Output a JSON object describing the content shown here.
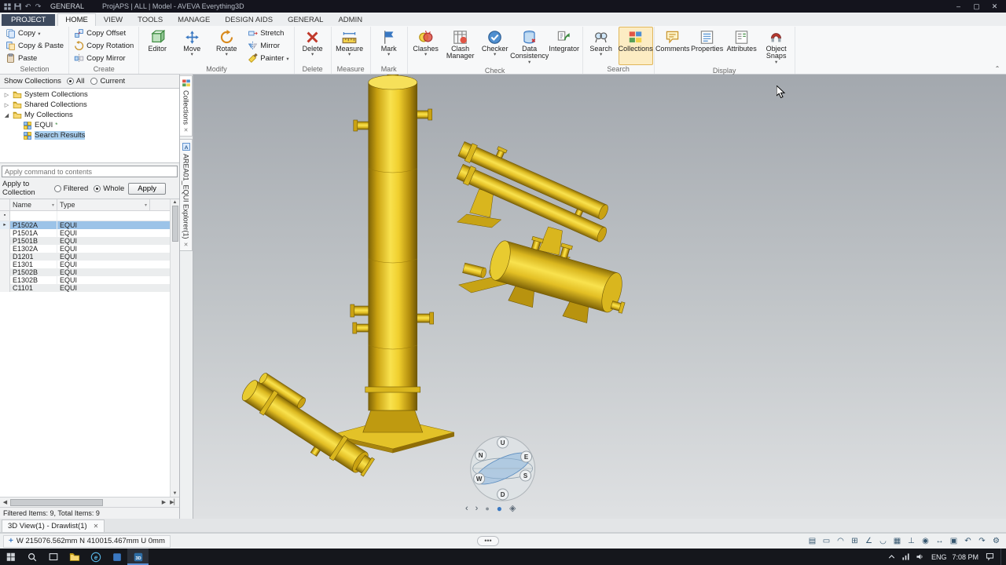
{
  "colors": {
    "accent_blue": "#3a78c2",
    "equipment_yellow": "#f0cd2b",
    "titlebar_bg": "#14141d",
    "taskbar_bg": "#15171c",
    "selection_blue": "#9cc3e8",
    "project_tab_bg": "#3e4a5e"
  },
  "titlebar": {
    "menu_label": "GENERAL",
    "title": "ProjAPS | ALL | Model - AVEVA Everything3D",
    "quick_icons": [
      "app-icon",
      "save-icon",
      "undo-icon",
      "redo-icon"
    ],
    "window_controls": [
      {
        "name": "minimize-button",
        "glyph": "–"
      },
      {
        "name": "maximize-button",
        "glyph": "▢"
      },
      {
        "name": "close-button",
        "glyph": "✕"
      }
    ]
  },
  "ribbon": {
    "active_tab": "HOME",
    "tabs": [
      "PROJECT",
      "HOME",
      "VIEW",
      "TOOLS",
      "MANAGE",
      "DESIGN AIDS",
      "GENERAL",
      "ADMIN"
    ],
    "groups": [
      {
        "label": "Selection",
        "stack": [
          {
            "label": "Copy",
            "icon": "copy",
            "dropdown": true
          },
          {
            "label": "Copy & Paste",
            "icon": "copy-paste",
            "dropdown": false
          },
          {
            "label": "Paste",
            "icon": "paste",
            "dropdown": false
          }
        ]
      },
      {
        "label": "Create",
        "stack": [
          {
            "label": "Copy Offset",
            "icon": "copy-offset",
            "dropdown": false
          },
          {
            "label": "Copy Rotation",
            "icon": "copy-rotation",
            "dropdown": false
          },
          {
            "label": "Copy Mirror",
            "icon": "copy-mirror",
            "dropdown": false
          }
        ]
      },
      {
        "label": "Modify",
        "large": [
          {
            "label": "Editor",
            "icon": "editor",
            "dropdown": false
          },
          {
            "label": "Move",
            "icon": "move",
            "dropdown": true
          },
          {
            "label": "Rotate",
            "icon": "rotate",
            "dropdown": true
          }
        ],
        "stack": [
          {
            "label": "Stretch",
            "icon": "stretch",
            "dropdown": false
          },
          {
            "label": "Mirror",
            "icon": "mirror",
            "dropdown": false
          },
          {
            "label": "Painter",
            "icon": "painter",
            "dropdown": true
          }
        ]
      },
      {
        "label": "Delete",
        "large": [
          {
            "label": "Delete",
            "icon": "delete",
            "dropdown": true
          }
        ]
      },
      {
        "label": "Measure",
        "large": [
          {
            "label": "Measure",
            "icon": "measure",
            "dropdown": true
          }
        ]
      },
      {
        "label": "Mark",
        "large": [
          {
            "label": "Mark",
            "icon": "mark",
            "dropdown": true
          }
        ]
      },
      {
        "label": "Check",
        "large": [
          {
            "label": "Clashes",
            "icon": "clashes",
            "dropdown": true
          },
          {
            "label": "Clash Manager",
            "icon": "clash-manager",
            "dropdown": false
          },
          {
            "label": "Checker",
            "icon": "checker",
            "dropdown": true
          },
          {
            "label": "Data Consistency",
            "icon": "data-consistency",
            "dropdown": true
          },
          {
            "label": "Integrator",
            "icon": "integrator",
            "dropdown": false
          }
        ]
      },
      {
        "label": "Search",
        "large": [
          {
            "label": "Search",
            "icon": "search",
            "dropdown": true
          },
          {
            "label": "Collections",
            "icon": "collections",
            "dropdown": false,
            "active": true
          }
        ]
      },
      {
        "label": "Display",
        "large": [
          {
            "label": "Comments",
            "icon": "comments",
            "dropdown": false
          },
          {
            "label": "Properties",
            "icon": "properties",
            "dropdown": false
          },
          {
            "label": "Attributes",
            "icon": "attributes",
            "dropdown": false
          },
          {
            "label": "Object Snaps",
            "icon": "object-snaps",
            "dropdown": true
          }
        ]
      }
    ]
  },
  "panel": {
    "show_collections_label": "Show Collections",
    "show_options": [
      {
        "label": "All",
        "selected": true
      },
      {
        "label": "Current",
        "selected": false
      }
    ],
    "tree": [
      {
        "label": "System Collections",
        "level": 0,
        "children": true,
        "expanded": false,
        "icon": "folder-icon"
      },
      {
        "label": "Shared Collections",
        "level": 0,
        "children": true,
        "expanded": false,
        "icon": "folder-icon"
      },
      {
        "label": "My Collections",
        "level": 0,
        "children": true,
        "expanded": true,
        "icon": "folder-icon"
      },
      {
        "label": "EQUI",
        "level": 1,
        "children": false,
        "icon": "grid-collection-icon",
        "suffix": "*"
      },
      {
        "label": "Search Results",
        "level": 1,
        "children": false,
        "icon": "grid-collection-icon",
        "selected": true
      }
    ],
    "apply_input_placeholder": "Apply command to contents",
    "apply_to_label": "Apply to Collection",
    "apply_options": [
      {
        "label": "Filtered",
        "selected": false
      },
      {
        "label": "Whole",
        "selected": true
      }
    ],
    "apply_button": "Apply",
    "grid": {
      "columns": [
        "Name",
        "Type"
      ],
      "rows": [
        {
          "name": "P1502A",
          "type": "EQUI",
          "selected": true
        },
        {
          "name": "P1501A",
          "type": "EQUI"
        },
        {
          "name": "P1501B",
          "type": "EQUI"
        },
        {
          "name": "E1302A",
          "type": "EQUI"
        },
        {
          "name": "D1201",
          "type": "EQUI"
        },
        {
          "name": "E1301",
          "type": "EQUI"
        },
        {
          "name": "P1502B",
          "type": "EQUI"
        },
        {
          "name": "E1302B",
          "type": "EQUI"
        },
        {
          "name": "C1101",
          "type": "EQUI"
        }
      ]
    },
    "status": "Filtered Items: 9, Total Items: 9",
    "side_tabs": [
      {
        "label": "Collections",
        "icon": "collections-icon",
        "closable": true,
        "active": true
      },
      {
        "label": "AREA01_EQUI Explorer(1)",
        "icon": "explorer-icon",
        "closable": true,
        "active": false
      }
    ]
  },
  "viewport": {
    "compass": {
      "up": "U",
      "north": "N",
      "east": "E",
      "west": "W",
      "south": "S",
      "down": "D"
    },
    "nav_icons": [
      "view-back-icon",
      "view-forward-icon",
      "record-icon",
      "orbit-view-icon",
      "iso-view-icon"
    ]
  },
  "view_tabs": [
    {
      "label": "3D View(1) - Drawlist(1)",
      "active": true,
      "closable": true
    }
  ],
  "statusbar": {
    "coordinates": "W 215076.562mm N 410015.467mm U 0mm",
    "center_bubble": "•••",
    "right_icons": [
      "view-settings-icon",
      "ruler-icon",
      "protractor-icon",
      "snap-grid-icon",
      "snap-angle-icon",
      "magnet-icon",
      "grid-icon",
      "axes-icon",
      "orbit-icon",
      "pan-icon",
      "zoom-window-icon",
      "previous-view-icon",
      "next-view-icon",
      "settings-icon"
    ]
  },
  "taskbar": {
    "items": [
      {
        "name": "start-button",
        "icon": "win-start"
      },
      {
        "name": "search-button",
        "icon": "search-taskbar"
      },
      {
        "name": "task-view-button",
        "icon": "taskview"
      },
      {
        "name": "file-explorer-button",
        "icon": "folder"
      },
      {
        "name": "edge-button",
        "icon": "edge"
      },
      {
        "name": "app-window-button",
        "icon": "ie-app"
      },
      {
        "name": "aveva-e3d-button",
        "icon": "e3d-app",
        "active": true
      }
    ],
    "tray": {
      "icons": [
        "chevron-up-icon",
        "network-icon",
        "volume-icon"
      ],
      "language": "ENG",
      "time": "7:08 PM",
      "action_center_icon": "action-center-icon"
    }
  }
}
